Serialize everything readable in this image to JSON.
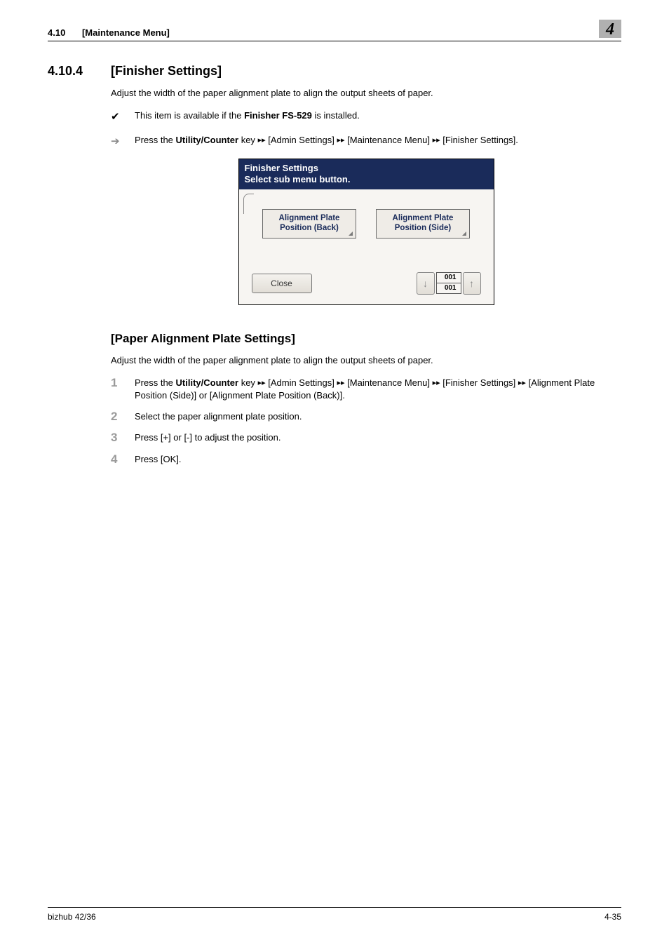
{
  "header": {
    "section_number": "4.10",
    "section_title": "[Maintenance Menu]",
    "chapter_number": "4"
  },
  "section": {
    "number": "4.10.4",
    "title": "[Finisher Settings]",
    "intro": "Adjust the width of the paper alignment plate to align the output sheets of paper.",
    "check_prefix": "This item is available if the ",
    "check_bold": "Finisher FS-529",
    "check_suffix": " is installed.",
    "nav_prefix": "Press the ",
    "nav_key": "Utility/Counter",
    "nav_key_suffix": " key ",
    "nav_sep": "▸▸",
    "nav_items": [
      " [Admin Settings] ",
      " [Maintenance Menu] ",
      " [Finisher Settings]."
    ]
  },
  "panel": {
    "title_line1": "Finisher Settings",
    "title_line2": "Select sub menu button.",
    "btn1_line1": "Alignment Plate",
    "btn1_line2": "Position (Back)",
    "btn2_line1": "Alignment Plate",
    "btn2_line2": "Position (Side)",
    "close": "Close",
    "page_current": "001",
    "page_total": "001"
  },
  "sub": {
    "title": "[Paper Alignment Plate Settings]",
    "intro": "Adjust the width of the paper alignment plate to align the output sheets of paper.",
    "steps": [
      {
        "n": "1",
        "prefix": "Press the ",
        "bold": "Utility/Counter",
        "mid": " key ",
        "sep": "▸▸",
        "seg1": " [Admin Settings] ",
        "seg2": " [Maintenance Menu] ",
        "seg3": " [Finisher Settings] ",
        "tail": "[Alignment Plate Position (Side)] or [Alignment Plate Position (Back)]."
      },
      {
        "n": "2",
        "text": "Select the paper alignment plate position."
      },
      {
        "n": "3",
        "text": "Press [+] or [-] to adjust the position."
      },
      {
        "n": "4",
        "text": "Press [OK]."
      }
    ]
  },
  "footer": {
    "left": "bizhub 42/36",
    "right": "4-35"
  }
}
